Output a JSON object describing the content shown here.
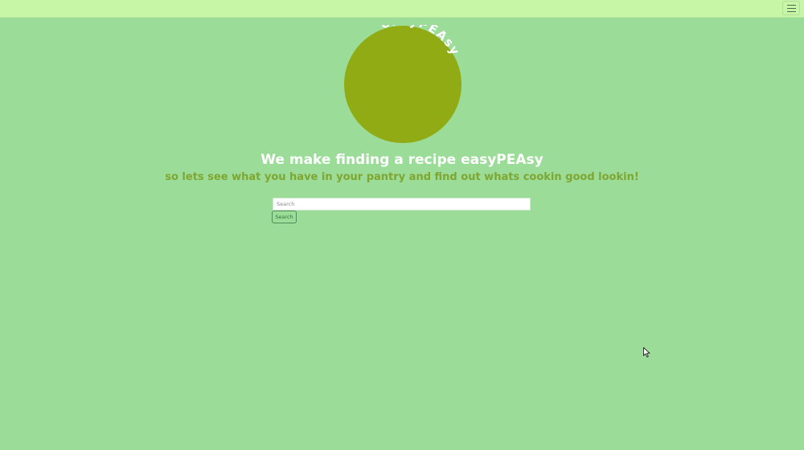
{
  "navbar": {
    "menu_icon": "hamburger-menu-icon"
  },
  "logo": {
    "text": "easyPEAsy",
    "circle_color": "#90ab13",
    "text_color": "#ffffff"
  },
  "hero": {
    "title": "We make finding a recipe easyPEAsy",
    "subtitle": "so lets see what you have in your pantry and find out whats cookin good lookin!"
  },
  "search": {
    "placeholder": "Search",
    "value": "",
    "button_label": "Search"
  },
  "colors": {
    "background": "#9bdc98",
    "navbar": "#c7f7a6",
    "subtitle": "#7fa630"
  }
}
